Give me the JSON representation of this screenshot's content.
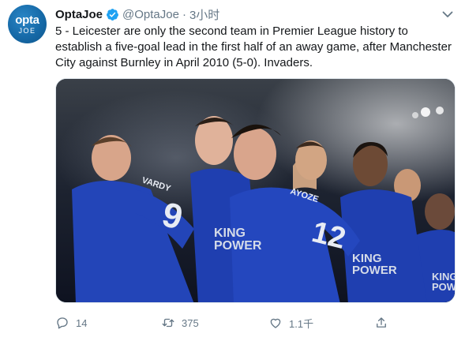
{
  "tweet": {
    "avatar_icon": "opta-joe-logo",
    "avatar_text_top": "opta",
    "avatar_text_bottom": "JOE",
    "name": "OptaJoe",
    "verified_icon": "verified-badge-icon",
    "handle": "@OptaJoe",
    "separator": "·",
    "time": "3小时",
    "menu_icon": "chevron-down-icon",
    "text": "5 - Leicester are only the second team in Premier League history to establish a five-goal lead in the first half of an away game, after Manchester City against Burnley in April 2010 (5-0). Invaders.",
    "photo": {
      "description_icon": "photo-leicester-players-celebrating",
      "shirt_texts": {
        "vardy": "VARDY",
        "vardy_number": "9",
        "ayoze": "AYOZE",
        "ayoze_number": "12",
        "sponsor_a": "KING\nPOWER",
        "sponsor_b": "KING\nPOWER",
        "sponsor_c": "KING\nPOWER"
      }
    },
    "actions": {
      "reply": {
        "icon": "reply-icon",
        "count": "14"
      },
      "retweet": {
        "icon": "retweet-icon",
        "count": "375"
      },
      "like": {
        "icon": "heart-icon",
        "count": "1.1千"
      },
      "share": {
        "icon": "share-icon",
        "count": ""
      }
    }
  },
  "colors": {
    "brand_blue": "#1da1f2",
    "text_primary": "#14171a",
    "text_secondary": "#657786",
    "kit_blue": "#1f3fb0",
    "opta_blue": "#166aa8"
  }
}
